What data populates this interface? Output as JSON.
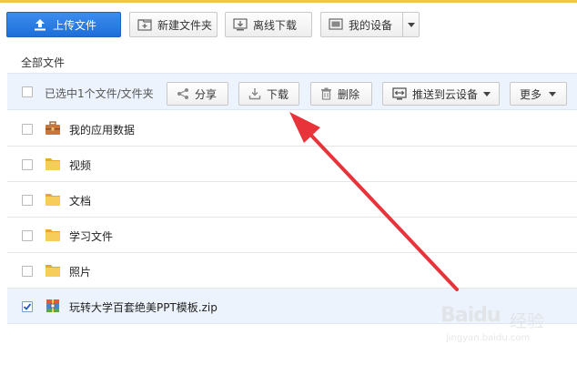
{
  "toolbar": {
    "upload_label": "上传文件",
    "new_folder_label": "新建文件夹",
    "offline_download_label": "离线下载",
    "my_devices_label": "我的设备"
  },
  "breadcrumb": {
    "label": "全部文件"
  },
  "actionbar": {
    "selected_text": "已选中1个文件/文件夹",
    "share_label": "分享",
    "download_label": "下载",
    "delete_label": "删除",
    "push_label": "推送到云设备",
    "more_label": "更多"
  },
  "files": [
    {
      "name": "我的应用数据",
      "icon": "briefcase-icon",
      "checked": false
    },
    {
      "name": "视频",
      "icon": "folder-icon",
      "checked": false
    },
    {
      "name": "文档",
      "icon": "folder-icon",
      "checked": false
    },
    {
      "name": "学习文件",
      "icon": "folder-icon",
      "checked": false
    },
    {
      "name": "照片",
      "icon": "folder-icon",
      "checked": false
    },
    {
      "name": "玩转大学百套绝美PPT模板.zip",
      "icon": "zip-icon",
      "checked": true
    }
  ],
  "watermark": {
    "logo": "Baidu",
    "text": "经验",
    "url": "jingyan.baidu.com"
  },
  "colors": {
    "accent": "#1d6fd8",
    "selected_bg": "#edf3fc",
    "folder": "#f2c14e",
    "arrow": "#e8333a",
    "top_line": "#f3c24a"
  }
}
